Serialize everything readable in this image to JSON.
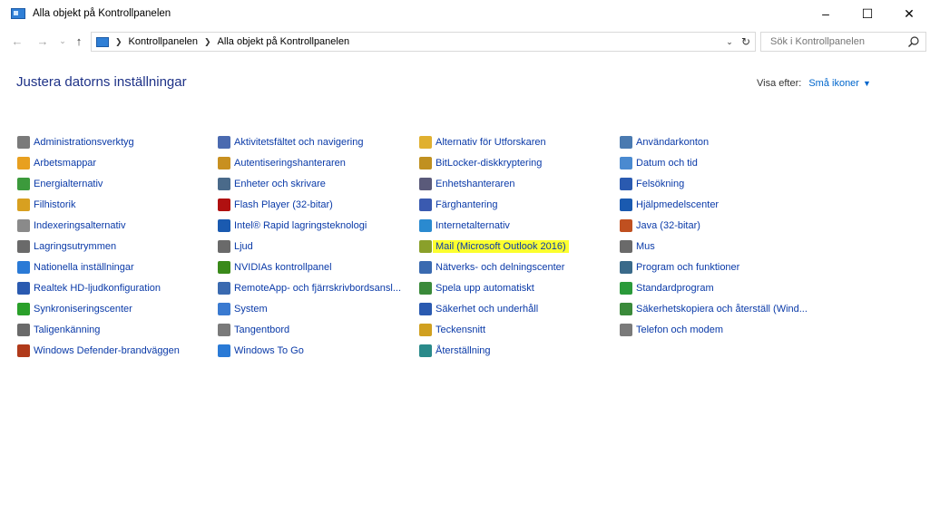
{
  "window": {
    "title": "Alla objekt på Kontrollpanelen"
  },
  "controls": {
    "minimize": "–",
    "maximize": "☐",
    "close": "✕"
  },
  "nav": {
    "back": "←",
    "forward": "→",
    "recent": "⌄",
    "up": "↑"
  },
  "address": {
    "crumbs": [
      "Kontrollpanelen",
      "Alla objekt på Kontrollpanelen"
    ]
  },
  "search": {
    "placeholder": "Sök i Kontrollpanelen"
  },
  "header": {
    "title": "Justera datorns inställningar",
    "view_by_label": "Visa efter:",
    "view_by_value": "Små ikoner"
  },
  "columns": [
    {
      "items": [
        {
          "label": "Administrationsverktyg",
          "icon": "admin-tools-icon",
          "color": "#7a7a7a"
        },
        {
          "label": "Arbetsmappar",
          "icon": "work-folders-icon",
          "color": "#e8a020"
        },
        {
          "label": "Energialternativ",
          "icon": "power-options-icon",
          "color": "#3c9a3c"
        },
        {
          "label": "Filhistorik",
          "icon": "file-history-icon",
          "color": "#d8a020"
        },
        {
          "label": "Indexeringsalternativ",
          "icon": "indexing-icon",
          "color": "#8a8a8a"
        },
        {
          "label": "Lagringsutrymmen",
          "icon": "storage-spaces-icon",
          "color": "#6a6a6a"
        },
        {
          "label": "Nationella inställningar",
          "icon": "region-icon",
          "color": "#2a7ad6"
        },
        {
          "label": "Realtek HD-ljudkonfiguration",
          "icon": "realtek-audio-icon",
          "color": "#2a5ab0"
        },
        {
          "label": "Synkroniseringscenter",
          "icon": "sync-center-icon",
          "color": "#2aa02a"
        },
        {
          "label": "Taligenkänning",
          "icon": "speech-icon",
          "color": "#6a6a6a"
        },
        {
          "label": "Windows Defender-brandväggen",
          "icon": "firewall-icon",
          "color": "#b03a1a"
        }
      ]
    },
    {
      "items": [
        {
          "label": "Aktivitetsfältet och navigering",
          "icon": "taskbar-icon",
          "color": "#4a6ab0"
        },
        {
          "label": "Autentiseringshanteraren",
          "icon": "credential-manager-icon",
          "color": "#c89020"
        },
        {
          "label": "Enheter och skrivare",
          "icon": "devices-printers-icon",
          "color": "#4a6a8a"
        },
        {
          "label": "Flash Player (32-bitar)",
          "icon": "flash-icon",
          "color": "#b01010"
        },
        {
          "label": "Intel® Rapid lagringsteknologi",
          "icon": "intel-rst-icon",
          "color": "#1a5ab0"
        },
        {
          "label": "Ljud",
          "icon": "sound-icon",
          "color": "#6a6a6a"
        },
        {
          "label": "NVIDIAs kontrollpanel",
          "icon": "nvidia-icon",
          "color": "#3a8a1a"
        },
        {
          "label": "RemoteApp- och fjärrskrivbordsansl...",
          "icon": "remoteapp-icon",
          "color": "#3a6ab0"
        },
        {
          "label": "System",
          "icon": "system-icon",
          "color": "#3a7ad0"
        },
        {
          "label": "Tangentbord",
          "icon": "keyboard-icon",
          "color": "#7a7a7a"
        },
        {
          "label": "Windows To Go",
          "icon": "windows-to-go-icon",
          "color": "#2a7ad6"
        }
      ]
    },
    {
      "items": [
        {
          "label": "Alternativ för Utforskaren",
          "icon": "explorer-options-icon",
          "color": "#e0b030"
        },
        {
          "label": "BitLocker-diskkryptering",
          "icon": "bitlocker-icon",
          "color": "#c09020"
        },
        {
          "label": "Enhetshanteraren",
          "icon": "device-manager-icon",
          "color": "#5a5a7a"
        },
        {
          "label": "Färghantering",
          "icon": "color-management-icon",
          "color": "#3a5ab0"
        },
        {
          "label": "Internetalternativ",
          "icon": "internet-options-icon",
          "color": "#2a8ad0"
        },
        {
          "label": "Mail (Microsoft Outlook 2016)",
          "icon": "mail-icon",
          "color": "#8aa02a",
          "highlight": true
        },
        {
          "label": "Nätverks- och delningscenter",
          "icon": "network-icon",
          "color": "#3a6ab0"
        },
        {
          "label": "Spela upp automatiskt",
          "icon": "autoplay-icon",
          "color": "#3a8a3a"
        },
        {
          "label": "Säkerhet och underhåll",
          "icon": "security-flag-icon",
          "color": "#2a5ab0"
        },
        {
          "label": "Teckensnitt",
          "icon": "fonts-icon",
          "color": "#d0a020"
        },
        {
          "label": "Återställning",
          "icon": "recovery-icon",
          "color": "#2a8a8a"
        }
      ]
    },
    {
      "items": [
        {
          "label": "Användarkonton",
          "icon": "user-accounts-icon",
          "color": "#4a7ab0"
        },
        {
          "label": "Datum och tid",
          "icon": "date-time-icon",
          "color": "#4a8ad0"
        },
        {
          "label": "Felsökning",
          "icon": "troubleshooting-icon",
          "color": "#2a5ab0"
        },
        {
          "label": "Hjälpmedelscenter",
          "icon": "ease-of-access-icon",
          "color": "#1a5ab0"
        },
        {
          "label": "Java (32-bitar)",
          "icon": "java-icon",
          "color": "#c05020"
        },
        {
          "label": "Mus",
          "icon": "mouse-icon",
          "color": "#6a6a6a"
        },
        {
          "label": "Program och funktioner",
          "icon": "programs-icon",
          "color": "#3a6a8a"
        },
        {
          "label": "Standardprogram",
          "icon": "default-programs-icon",
          "color": "#2a9a3a"
        },
        {
          "label": "Säkerhetskopiera och återställ (Wind...",
          "icon": "backup-icon",
          "color": "#3a8a3a"
        },
        {
          "label": "Telefon och modem",
          "icon": "phone-modem-icon",
          "color": "#7a7a7a"
        }
      ]
    }
  ]
}
